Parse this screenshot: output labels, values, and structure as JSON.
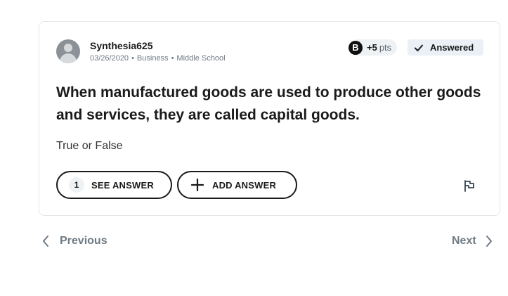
{
  "question": {
    "author": "Synthesia625",
    "date": "03/26/2020",
    "subject": "Business",
    "level": "Middle School",
    "points_value": "+5",
    "points_unit": "pts",
    "points_badge_letter": "B",
    "status": "Answered",
    "title": "When manufactured goods are used to produce other goods and services, they are called capital goods.",
    "body": "True or False"
  },
  "actions": {
    "see_answer_count": "1",
    "see_answer_label": "SEE ANSWER",
    "add_answer_label": "ADD ANSWER"
  },
  "navigation": {
    "previous_label": "Previous",
    "next_label": "Next"
  },
  "icons": {
    "avatar": "user-avatar-icon",
    "check": "check-icon",
    "plus": "plus-icon",
    "flag": "flag-icon",
    "prev": "chevron-left-icon",
    "next": "chevron-right-icon"
  },
  "colors": {
    "text": "#1a1a1a",
    "muted": "#6e7a85",
    "badge_bg": "#eef2f5",
    "answered_bg": "#eaf0f5",
    "border": "#e4e7ea"
  }
}
